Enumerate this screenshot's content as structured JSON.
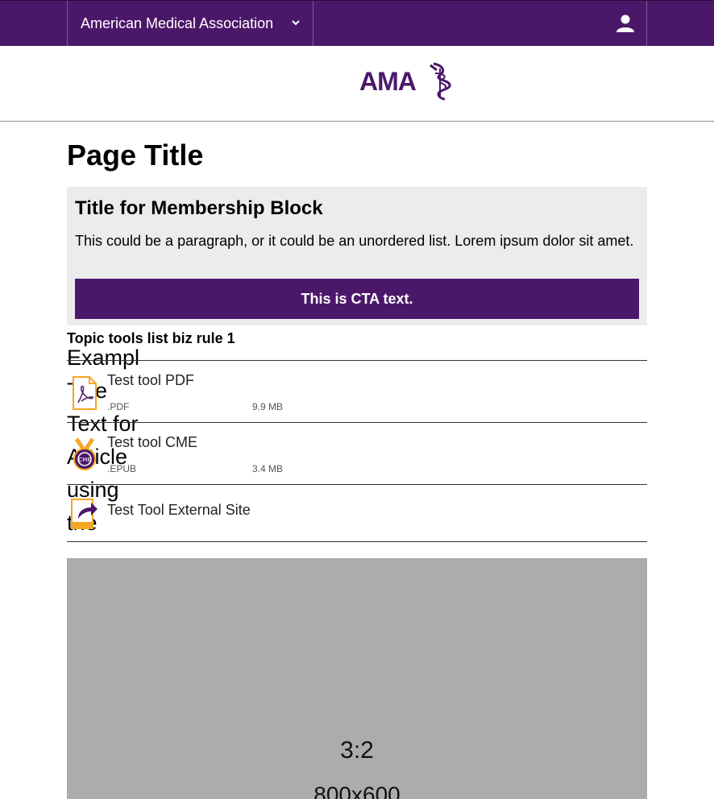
{
  "header": {
    "org_name": "American Medical Association",
    "logo_text": "AMA"
  },
  "page": {
    "title": "Page Title"
  },
  "membership": {
    "title": "Title for Membership Block",
    "text": "This could be a paragraph, or it could be an unordered list. Lorem ipsum dolor sit amet.",
    "cta": "This is CTA text."
  },
  "tools": {
    "title": "Topic tools list biz rule 1",
    "overlap_text": "Example Title Text for Article using the",
    "items": [
      {
        "name": "Test tool PDF",
        "ext": ".PDF",
        "size": "9.9 MB"
      },
      {
        "name": "Test tool CME",
        "ext": ".EPUB",
        "size": "3.4 MB"
      },
      {
        "name": "Test Tool External Site"
      }
    ]
  },
  "image_placeholder": {
    "ratio": "3:2",
    "dims": "800x600"
  },
  "colors": {
    "brand": "#4b1869",
    "accent": "#f5a623",
    "block_bg": "#ececec",
    "placeholder": "#acacac"
  }
}
